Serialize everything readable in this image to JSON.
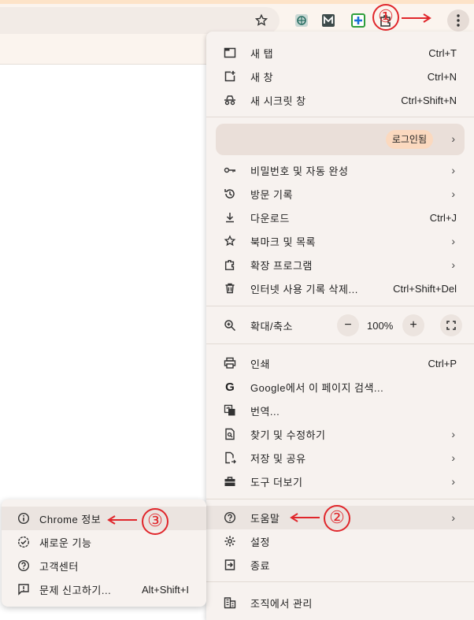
{
  "menu": {
    "new_tab": {
      "label": "새 탭",
      "shortcut": "Ctrl+T"
    },
    "new_window": {
      "label": "새 창",
      "shortcut": "Ctrl+N"
    },
    "incognito": {
      "label": "새 시크릿 창",
      "shortcut": "Ctrl+Shift+N"
    },
    "signin": {
      "label": "로그인됨"
    },
    "passwords": {
      "label": "비밀번호 및 자동 완성"
    },
    "history": {
      "label": "방문 기록"
    },
    "downloads": {
      "label": "다운로드",
      "shortcut": "Ctrl+J"
    },
    "bookmarks": {
      "label": "북마크 및 목록"
    },
    "extensions": {
      "label": "확장 프로그램"
    },
    "clear_data": {
      "label": "인터넷 사용 기록 삭제...",
      "shortcut": "Ctrl+Shift+Del"
    },
    "zoom": {
      "label": "확대/축소",
      "value": "100%",
      "minus": "−",
      "plus": "+"
    },
    "print": {
      "label": "인쇄",
      "shortcut": "Ctrl+P"
    },
    "search_page": {
      "label": "Google에서 이 페이지 검색..."
    },
    "translate": {
      "label": "번역..."
    },
    "find_edit": {
      "label": "찾기 및 수정하기"
    },
    "save_share": {
      "label": "저장 및 공유"
    },
    "more_tools": {
      "label": "도구 더보기"
    },
    "help": {
      "label": "도움말"
    },
    "settings": {
      "label": "설정"
    },
    "exit": {
      "label": "종료"
    },
    "managed": {
      "label": "조직에서 관리"
    }
  },
  "submenu": {
    "about": {
      "label": "Chrome 정보"
    },
    "whats_new": {
      "label": "새로운 기능"
    },
    "help_center": {
      "label": "고객센터"
    },
    "report": {
      "label": "문제 신고하기...",
      "shortcut": "Alt+Shift+I"
    }
  },
  "annotations": {
    "one": "①",
    "two": "②",
    "three": "③"
  },
  "colors": {
    "accent": "#e0262b",
    "menu_bg": "#f7f2ef",
    "toolbar_bg": "#fbf4ee"
  }
}
